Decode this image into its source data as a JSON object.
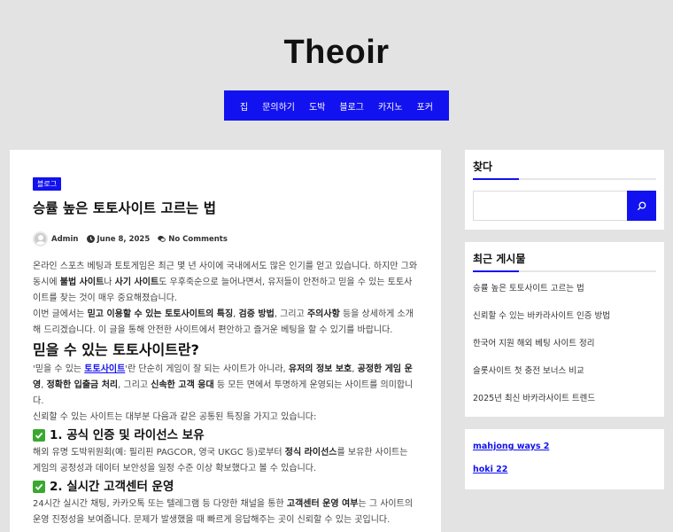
{
  "site": {
    "title": "Theoir"
  },
  "nav": [
    {
      "label": "집"
    },
    {
      "label": "문의하기"
    },
    {
      "label": "도박"
    },
    {
      "label": "블로그"
    },
    {
      "label": "카지노"
    },
    {
      "label": "포커"
    }
  ],
  "post": {
    "category": "블로그",
    "title": "승률 높은 토토사이트 고르는 법",
    "author": "Admin",
    "date": "June 8, 2025",
    "comments": "No Comments",
    "p1": {
      "t1": "온라인 스포츠 베팅과 토토게임은 최근 몇 년 사이에 국내에서도 많은 인기를 얻고 있습니다. 하지만 그와 동시에 ",
      "b1": "불법 사이트",
      "t2": "나 ",
      "b2": "사기 사이트",
      "t3": "도 우후죽순으로 늘어나면서, 유저들이 안전하고 믿을 수 있는 토토사이트를 찾는 것이 매우 중요해졌습니다."
    },
    "p2": {
      "t1": "이번 글에서는 ",
      "b1": "믿고 이용할 수 있는 토토사이트의 특징",
      "t2": ", ",
      "b2": "검증 방법",
      "t3": ", 그리고 ",
      "b3": "주의사항",
      "t4": " 등을 상세하게 소개해 드리겠습니다. 이 글을 통해 안전한 사이트에서 편안하고 즐거운 베팅을 할 수 있기를 바랍니다."
    },
    "h2": "믿을 수 있는 토토사이트란?",
    "p3": {
      "t1": "'믿을 수 있는 ",
      "link": "토토사이트",
      "t2": "'란 단순히 게임이 잘 되는 사이트가 아니라, ",
      "b1": "유저의 정보 보호",
      "t3": ", ",
      "b2": "공정한 게임 운영",
      "t4": ", ",
      "b3": "정확한 입출금 처리",
      "t5": ", 그리고 ",
      "b4": "신속한 고객 응대",
      "t6": " 등 모든 면에서 투명하게 운영되는 사이트를 의미합니다."
    },
    "p4": "신뢰할 수 있는 사이트는 대부분 다음과 같은 공통된 특징을 가지고 있습니다:",
    "h3a": "1. 공식 인증 및 라이선스 보유",
    "p5": {
      "t1": "해외 유명 도박위원회(예: 필리핀 PAGCOR, 영국 UKGC 등)로부터 ",
      "b1": "정식 라이선스",
      "t2": "를 보유한 사이트는 게임의 공정성과 데이터 보안성을 일정 수준 이상 확보했다고 볼 수 있습니다."
    },
    "h3b": "2. 실시간 고객센터 운영",
    "p6": {
      "t1": "24시간 실시간 채팅, 카카오톡 또는 텔레그램 등 다양한 채널을 통한 ",
      "b1": "고객센터 운영 여부",
      "t2": "는 그 사이트의 운영 진정성을 보여줍니다. 문제가 발생했을 때 빠르게 응답해주는 곳이 신뢰할 수 있는 곳입니다."
    }
  },
  "sidebar": {
    "search": {
      "title": "찾다",
      "placeholder": ""
    },
    "recent": {
      "title": "최근 게시물",
      "items": [
        "승률 높은 토토사이트 고르는 법",
        "신뢰할 수 있는 바카라사이트 인증 방법",
        "한국어 지원 해외 베팅 사이트 정리",
        "슬롯사이트 첫 충전 보너스 비교",
        "2025년 최신 바카라사이트 트렌드"
      ]
    },
    "links": [
      "mahjong ways 2",
      "hoki 22"
    ]
  },
  "colors": {
    "accent": "#1212f0",
    "background": "#e3e3e3",
    "check": "#3aa830"
  }
}
